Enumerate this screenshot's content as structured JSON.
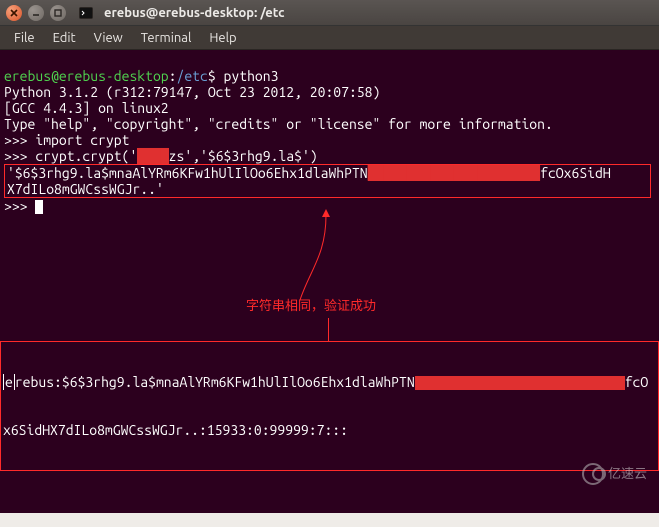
{
  "window": {
    "title": "erebus@erebus-desktop: /etc"
  },
  "menu": {
    "file": "File",
    "edit": "Edit",
    "view": "View",
    "terminal": "Terminal",
    "help": "Help"
  },
  "term": {
    "prompt_user": "erebus@erebus-desktop",
    "prompt_sep": ":",
    "prompt_path": "/etc",
    "prompt_sym": "$",
    "cmd1": "python3",
    "py_banner1": "Python 3.1.2 (r312:79147, Oct 23 2012, 20:07:58)",
    "py_banner2": "[GCC 4.4.3] on linux2",
    "py_banner3": "Type \"help\", \"copyright\", \"credits\" or \"license\" for more information.",
    "ps": ">>>",
    "cmd2": "import crypt",
    "cmd3_pre": "crypt.crypt('",
    "cmd3_redact": "████",
    "cmd3_mid": "zs','$6$3rhg9.la$')",
    "hash_line1_a": "'$6$3rhg9.la$mnaAlYRm6KFw1hUlIlOo6Ehx1dlaWhPTN",
    "hash_line1_redact": "██████████████████████",
    "hash_line1_b": "fcOx6SidH",
    "hash_line2": "X7dILo8mGWCssWGJr..'"
  },
  "annotation": {
    "text": "字符串相同，验证成功"
  },
  "bottom": {
    "row1_a_prefix": "e",
    "row1_a": "rebus:$6$3rhg9.la$mnaAlYRm6KFw1hUlIlOo6Ehx1dlaWhPTN",
    "row1_b": "fcO",
    "row2": "x6SidHX7dILo8mGWCssWGJr..:15933:0:99999:7:::"
  },
  "watermark": {
    "text": "亿速云"
  },
  "colors": {
    "terminal_bg": "#2c001e",
    "accent_red": "#ff2a2a",
    "redact_red": "#e03030",
    "prompt_green": "#4fd24f",
    "path_blue": "#6a9fd4"
  }
}
